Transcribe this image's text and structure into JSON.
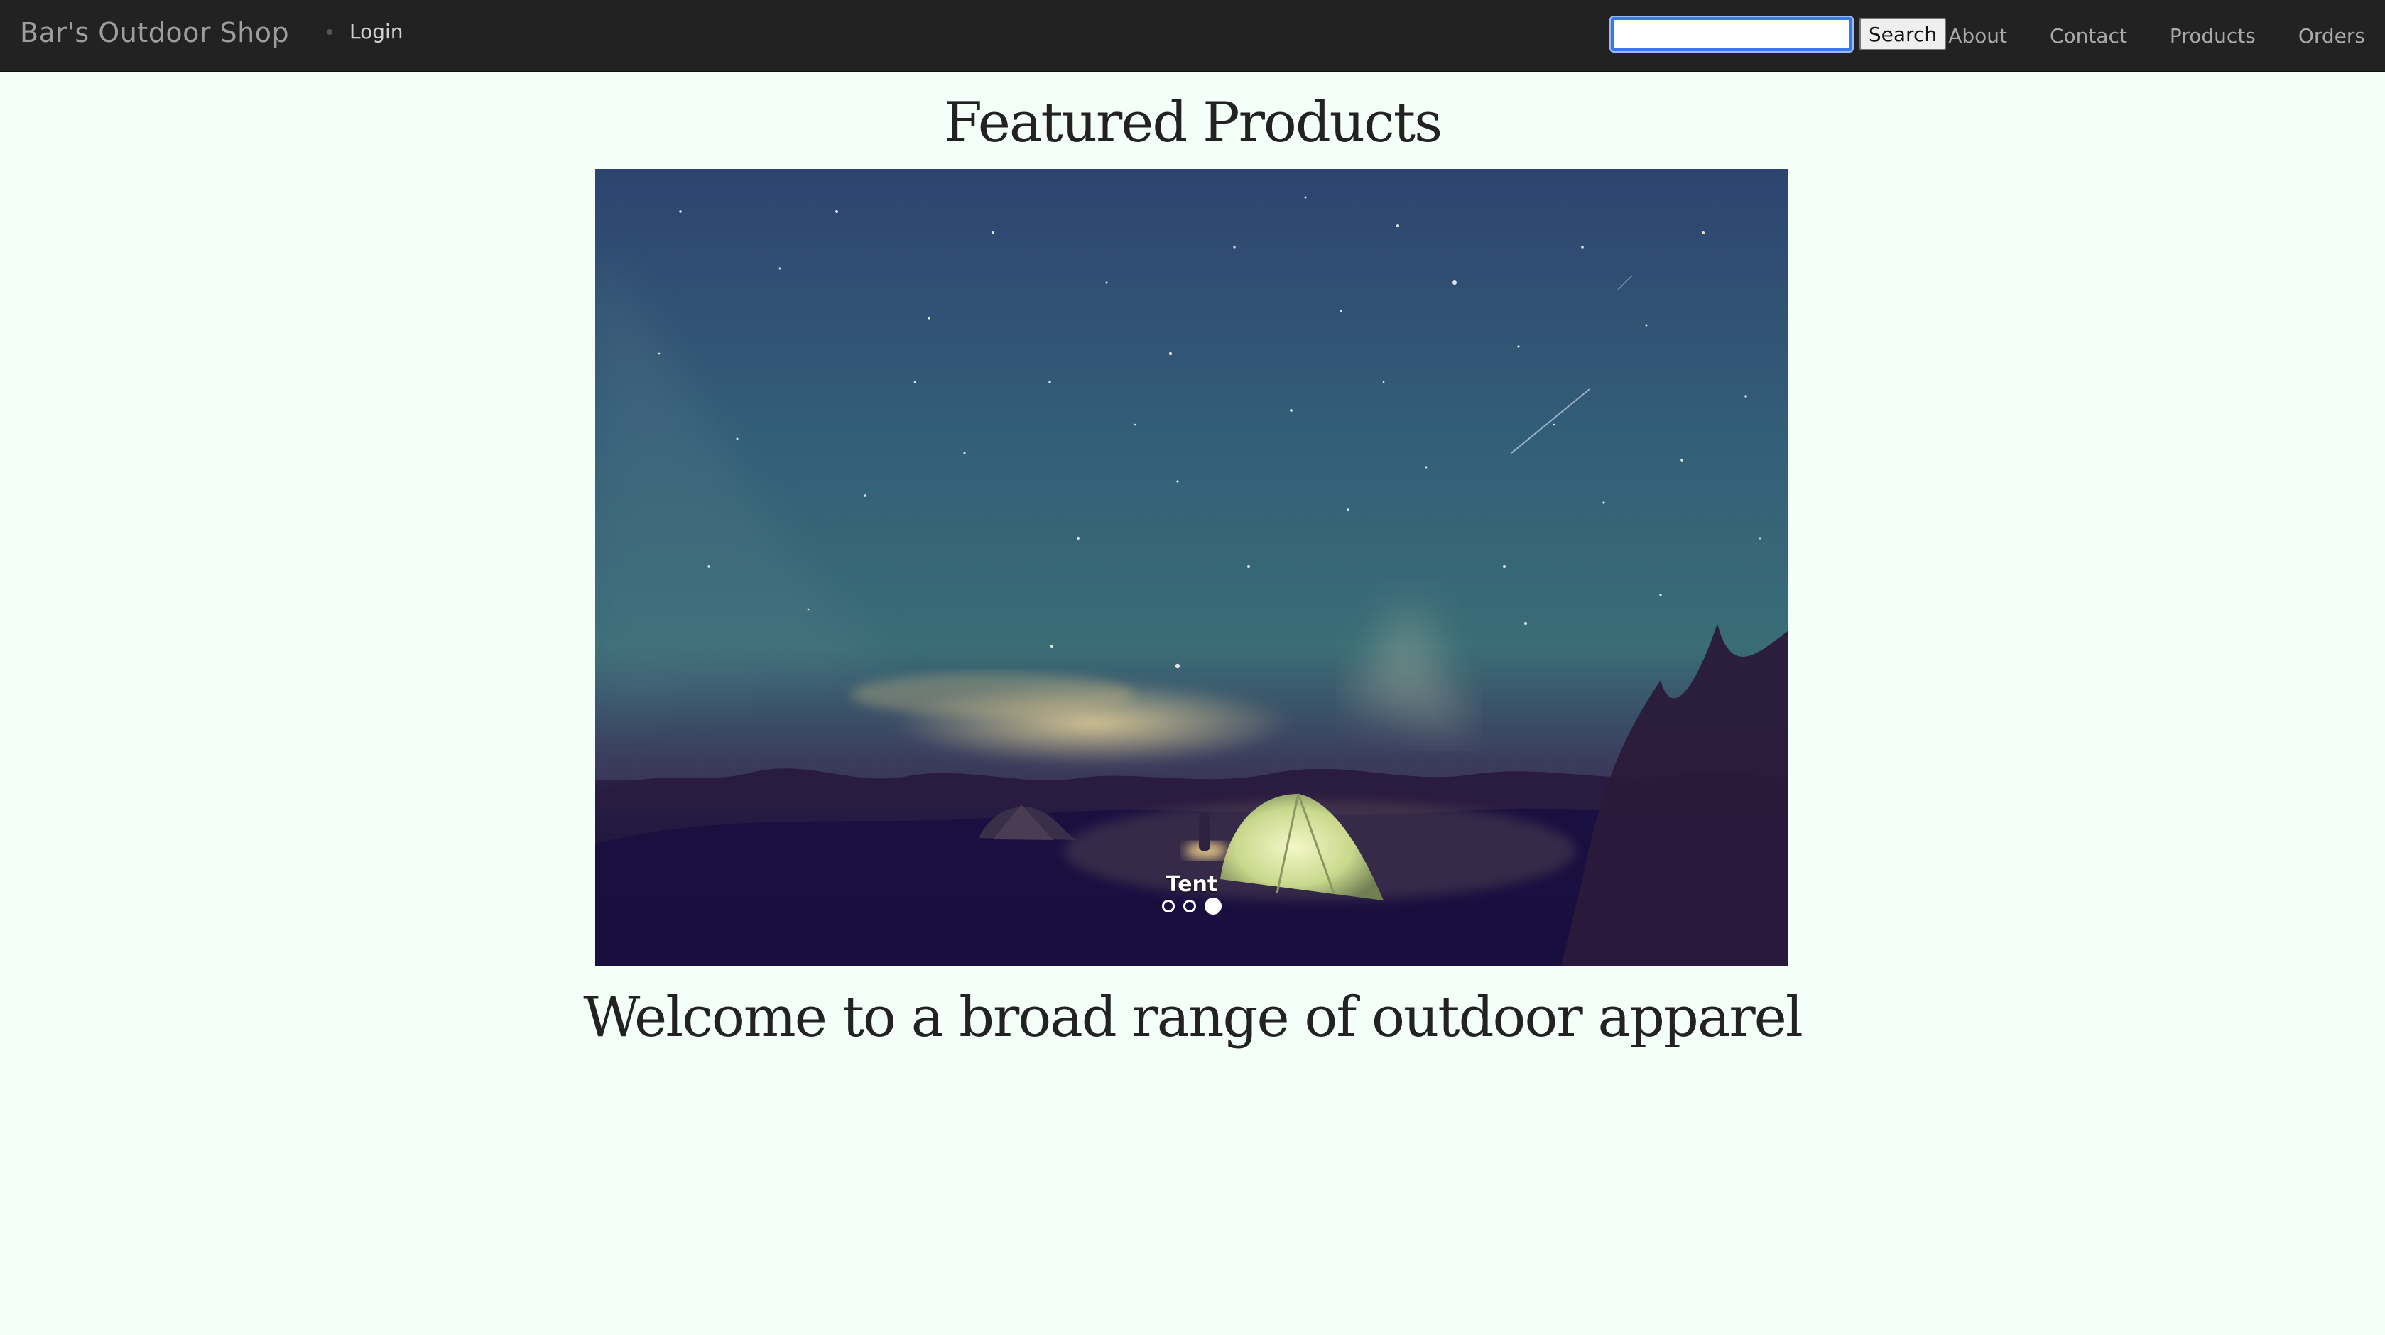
{
  "navbar": {
    "brand": "Bar's Outdoor Shop",
    "login_label": "Login",
    "search": {
      "value": "",
      "placeholder": "",
      "button_label": "Search"
    },
    "links": {
      "about": "About",
      "contact": "Contact",
      "products": "Products",
      "orders": "Orders"
    }
  },
  "main": {
    "featured_title": "Featured Products",
    "carousel": {
      "image_icon": "night-camping-tent-photo",
      "caption": "Tent",
      "slide_count": 3,
      "active_slide": 3
    },
    "welcome_text": "Welcome to a broad range of outdoor apparel"
  },
  "colors": {
    "navbar_bg": "#222222",
    "page_bg": "#f5fff9",
    "search_focus": "#3b78e7"
  }
}
